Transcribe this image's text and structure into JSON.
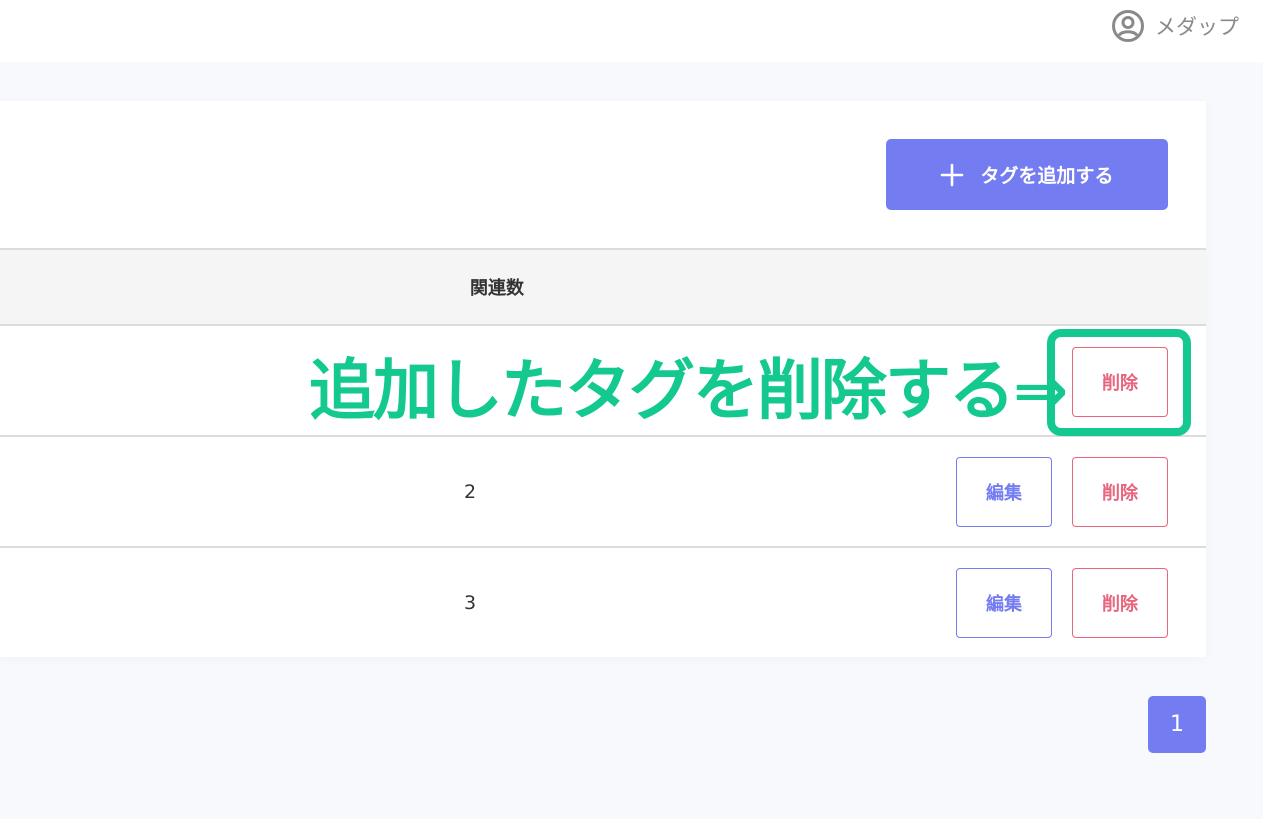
{
  "header": {
    "user_name": "メダップ",
    "user_icon": "user-circle-icon"
  },
  "toolbar": {
    "add_label": "タグを追加する",
    "add_icon": "plus-icon"
  },
  "table": {
    "columns": {
      "count": "関連数"
    },
    "rows": [
      {
        "count": "",
        "edit_label": "",
        "delete_label": "削除"
      },
      {
        "count": "2",
        "edit_label": "編集",
        "delete_label": "削除"
      },
      {
        "count": "3",
        "edit_label": "編集",
        "delete_label": "削除"
      }
    ]
  },
  "annotation": {
    "text": "追加したタグを削除する⇒",
    "color": "#13c98f"
  },
  "pagination": {
    "current_page": "1"
  },
  "colors": {
    "accent": "#747cf2",
    "danger": "#e8657e",
    "annotation": "#13c98f"
  }
}
